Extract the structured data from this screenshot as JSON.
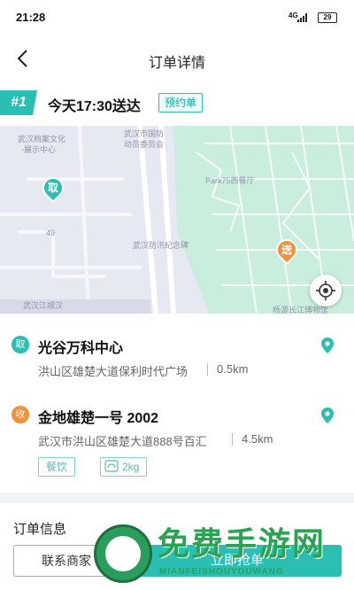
{
  "status_bar": {
    "time": "21:28",
    "network": "4G",
    "battery": "29"
  },
  "nav": {
    "title": "订单详情"
  },
  "order": {
    "number": "#1",
    "deliver_time": "今天17:30送达",
    "tag": "预约单"
  },
  "map": {
    "labels": [
      "武汉档案文化",
      "-展示中心",
      "武汉市国防",
      "动员委员会",
      "Park75西餐厅",
      "武汉防汛纪念碑",
      "49",
      "武汉江城汉",
      "杨源长江博物馆"
    ],
    "pickup_marker": "取",
    "delivery_marker": "送"
  },
  "pickup": {
    "badge": "取",
    "name": "光谷万科中心",
    "address": "洪山区雄楚大道保利时代广场",
    "distance": "0.5km"
  },
  "delivery": {
    "badge": "收",
    "name": "金地雄楚一号 2002",
    "address": "武汉市洪山区雄楚大道888号百汇",
    "distance": "4.5km"
  },
  "tags": {
    "category": "餐饮",
    "weight": "2kg"
  },
  "info": {
    "title": "订单信息",
    "contact_button": "联系商家",
    "grab_button": "立即抢单"
  },
  "watermark": {
    "title": "免费手游网",
    "subtitle": "MIANFEISHOUYOUWANG"
  },
  "colors": {
    "accent": "#2bbfb3",
    "delivery_badge": "#f0923b",
    "pickup_badge": "#2bbfb3"
  }
}
